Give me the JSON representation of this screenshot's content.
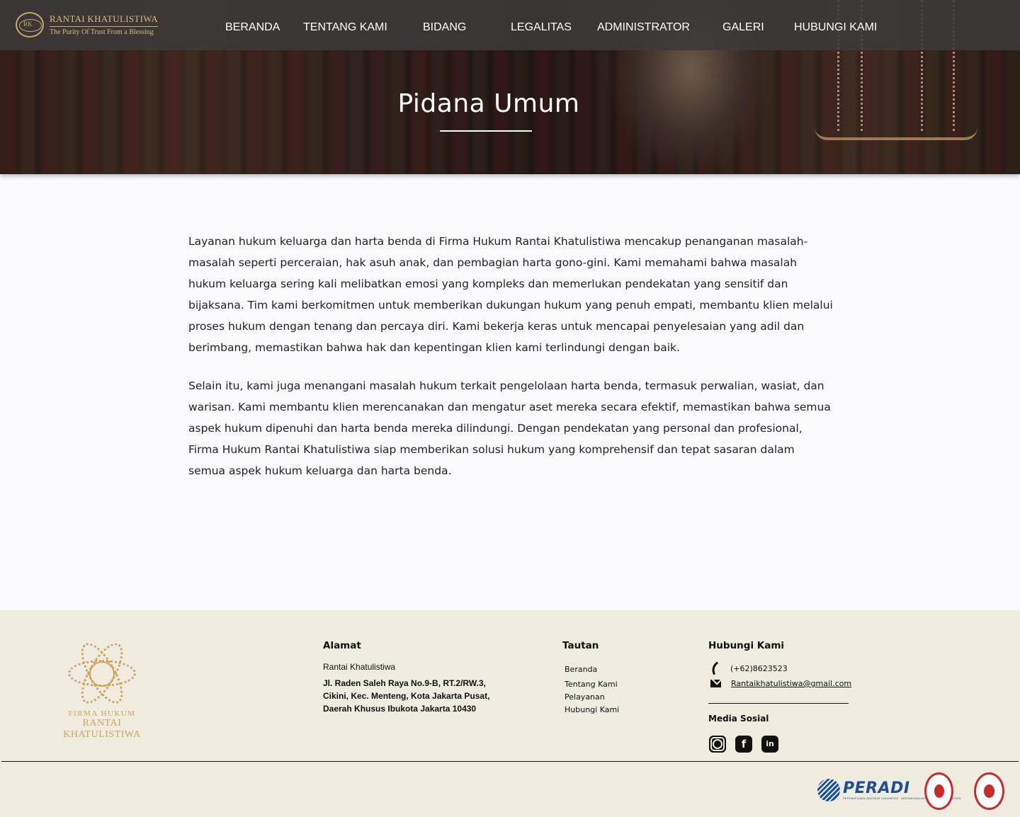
{
  "brand": {
    "name": "RANTAI KHATULISTIWA",
    "tagline": "The Purity Of Trust From a Blessing",
    "monogram": "RK"
  },
  "nav": {
    "items": [
      "BERANDA",
      "TENTANG KAMI",
      "BIDANG",
      "LEGALITAS",
      "ADMINISTRATOR",
      "GALERI",
      "HUBUNGI KAMI"
    ]
  },
  "hero": {
    "title": "Pidana Umum"
  },
  "content": {
    "paragraphs": [
      "Layanan hukum keluarga dan harta benda di Firma Hukum Rantai Khatulistiwa mencakup penanganan masalah-masalah seperti perceraian, hak asuh anak, dan pembagian harta gono-gini. Kami memahami bahwa masalah hukum keluarga sering kali melibatkan emosi yang kompleks dan memerlukan pendekatan yang sensitif dan bijaksana. Tim kami berkomitmen untuk memberikan dukungan hukum yang penuh empati, membantu klien melalui proses hukum dengan tenang dan percaya diri. Kami bekerja keras untuk mencapai penyelesaian yang adil dan berimbang, memastikan bahwa hak dan kepentingan klien kami terlindungi dengan baik.",
      "Selain itu, kami juga menangani masalah hukum terkait pengelolaan harta benda, termasuk perwalian, wasiat, dan warisan. Kami membantu klien merencanakan dan mengatur aset mereka secara efektif, memastikan bahwa semua aspek hukum dipenuhi dan harta benda mereka dilindungi. Dengan pendekatan yang personal dan profesional, Firma Hukum Rantai Khatulistiwa siap memberikan solusi hukum yang komprehensif dan tepat sasaran dalam semua aspek hukum keluarga dan harta benda."
    ]
  },
  "footer": {
    "logo_small": "FIRMA HUKUM",
    "logo_big": "RANTAI KHATULISTIWA",
    "address": {
      "heading": "Alamat",
      "name": "Rantai Khatulistiwa",
      "lines": [
        "Jl. Raden Saleh Raya No.9-B, RT.2/RW.3,",
        "Cikini, Kec. Menteng, Kota Jakarta Pusat,",
        "Daerah Khusus Ibukota Jakarta 10430"
      ]
    },
    "links": {
      "heading": "Tautan",
      "items": [
        "Beranda",
        "Tentang Kami",
        "Pelayanan",
        "Hubungi Kami"
      ]
    },
    "contact": {
      "heading": "Hubungi Kami",
      "phone": "(+62)8623523",
      "email": "Rantaikhatulistiwa@gmail.com"
    },
    "social": {
      "heading": "Media Sosial",
      "icons": [
        "instagram-icon",
        "facebook-icon",
        "linkedin-icon"
      ]
    },
    "partners": {
      "peradi_name": "PERADI",
      "peradi_sub": "PERHIMPUNAN ADVOKAT INDONESIA · INDONESIAN ADVOCATES ASSOCIATION"
    }
  },
  "colors": {
    "gold": "#c9a560",
    "footer_bg": "#f0ebdf",
    "navbar_bg": "#3c3a3a",
    "peradi_blue": "#1d4f95",
    "seal_red": "#c92b2b"
  }
}
